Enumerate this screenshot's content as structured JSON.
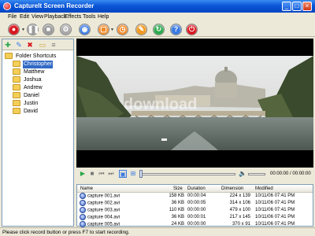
{
  "window": {
    "title": "CaptureIt Screen Recorder"
  },
  "menu": [
    "File",
    "Edit",
    "View",
    "Playback",
    "Effects",
    "Tools",
    "Help"
  ],
  "toolbar": {
    "buttons": [
      {
        "icon": "record-icon",
        "color": "#d8141c"
      },
      {
        "icon": "pause-icon",
        "color": "#9a9a9a"
      },
      {
        "icon": "stop-icon",
        "color": "#9a9a9a"
      },
      {
        "icon": "settings-icon",
        "color": "#a0a0a0"
      },
      {
        "icon": "webcam-icon",
        "color": "#3a7ae0"
      },
      {
        "icon": "region-icon",
        "color": "#f08a2a"
      },
      {
        "icon": "timer-icon",
        "color": "#f08a2a"
      },
      {
        "icon": "edit-icon",
        "color": "#f09a20"
      },
      {
        "icon": "refresh-icon",
        "color": "#2aa84a"
      },
      {
        "icon": "help-icon",
        "color": "#3a7ae0"
      },
      {
        "icon": "power-icon",
        "color": "#d8141c"
      }
    ]
  },
  "tree": {
    "root": "Folder Shortcuts",
    "folders": [
      "Christopher",
      "Matthew",
      "Joshua",
      "Andrew",
      "Daniel",
      "Justin",
      "David"
    ],
    "selected": "Christopher"
  },
  "player": {
    "time": "00:00:00 / 00:00:00",
    "progress": 0
  },
  "video": {
    "watermark": "download"
  },
  "files": {
    "columns": [
      "Name",
      "Size",
      "Duration",
      "Dimension",
      "Modified"
    ],
    "rows": [
      {
        "name": "capture 001.avi",
        "size": "158 KB",
        "duration": "00:00:04",
        "dimension": "224 x 139",
        "modified": "10/11/06 07:41 PM"
      },
      {
        "name": "capture 002.avi",
        "size": "36 KB",
        "duration": "00:00:05",
        "dimension": "314 x 106",
        "modified": "10/11/06 07:41 PM"
      },
      {
        "name": "capture 003.avi",
        "size": "110 KB",
        "duration": "00:00:00",
        "dimension": "479 x 100",
        "modified": "10/11/06 07:41 PM"
      },
      {
        "name": "capture 004.avi",
        "size": "36 KB",
        "duration": "00:00:01",
        "dimension": "217 x 145",
        "modified": "10/11/06 07:41 PM"
      },
      {
        "name": "capture 005.avi",
        "size": "24 KB",
        "duration": "00:00:00",
        "dimension": "370 x 91",
        "modified": "10/11/06 07:41 PM"
      }
    ]
  },
  "status": "Please click record button or press F7 to start recording."
}
